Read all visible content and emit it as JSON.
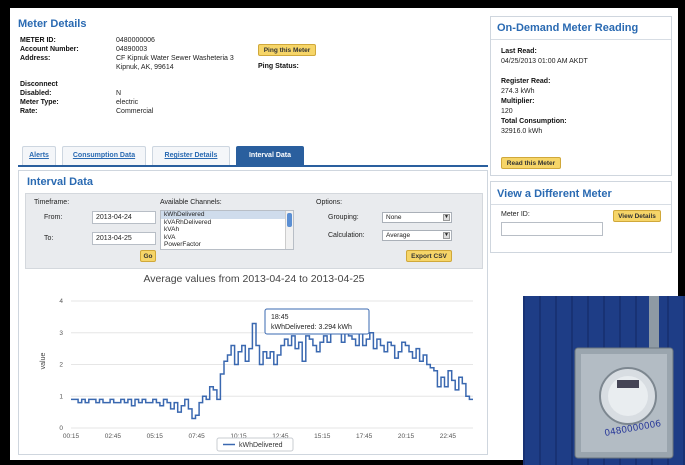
{
  "meter_details": {
    "title": "Meter Details",
    "fields": [
      {
        "label": "METER ID:",
        "value": "0480000006"
      },
      {
        "label": "Account Number:",
        "value": "04890003"
      },
      {
        "label": "Address:",
        "value": "CF Kipnuk Water Sewer Washeteria 3"
      },
      {
        "label": "",
        "value": "Kipnuk, AK, 99614"
      },
      {
        "label": "Disconnect",
        "value": ""
      },
      {
        "label": "Disabled:",
        "value": "N"
      },
      {
        "label": "Meter Type:",
        "value": "electric"
      },
      {
        "label": "Rate:",
        "value": "Commercial"
      }
    ],
    "ping_button": "Ping this Meter",
    "ping_status_label": "Ping Status:"
  },
  "tabs": [
    {
      "label": "Alerts",
      "active": false
    },
    {
      "label": "Consumption Data",
      "active": false
    },
    {
      "label": "Register Details",
      "active": false
    },
    {
      "label": "Interval Data",
      "active": true
    }
  ],
  "interval": {
    "title": "Interval Data",
    "timeframe_label": "Timeframe:",
    "from_label": "From:",
    "from_value": "2013-04-24",
    "to_label": "To:",
    "to_value": "2013-04-25",
    "go_button": "Go",
    "channels_label": "Available Channels:",
    "channels": [
      "kWhDelivered",
      "kVARhDelivered",
      "kVAh",
      "kVA",
      "PowerFactor"
    ],
    "selected_channel": "kWhDelivered",
    "options_label": "Options:",
    "grouping_label": "Grouping:",
    "grouping_value": "None",
    "calculation_label": "Calculation:",
    "calculation_value": "Average",
    "export_button": "Export CSV"
  },
  "chart_data": {
    "type": "line",
    "title": "Average values from 2013-04-24 to 2013-04-25",
    "xlabel": "",
    "ylabel": "value",
    "ylim": [
      0,
      4
    ],
    "yticks": [
      "0",
      "1",
      "2",
      "3",
      "4"
    ],
    "xticks": [
      "00:15",
      "02:45",
      "05:15",
      "07:45",
      "10:15",
      "12:45",
      "15:15",
      "17:45",
      "20:15",
      "22:45"
    ],
    "legend": "bottom-center",
    "series": [
      {
        "name": "kWhDelivered",
        "color": "#3a68b0",
        "values": [
          0.9,
          0.9,
          0.8,
          0.9,
          0.8,
          0.9,
          0.9,
          0.8,
          0.9,
          0.8,
          0.8,
          0.9,
          0.8,
          0.8,
          0.9,
          0.8,
          0.9,
          0.7,
          0.9,
          0.8,
          0.9,
          0.8,
          0.8,
          0.9,
          0.8,
          0.7,
          0.9,
          0.8,
          0.6,
          0.8,
          0.5,
          0.7,
          0.9,
          0.6,
          0.3,
          0.4,
          0.8,
          1.0,
          0.9,
          1.3,
          1.2,
          0.9,
          1.7,
          2.1,
          2.3,
          2.6,
          2.0,
          2.4,
          2.6,
          2.1,
          2.5,
          3.29,
          2.6,
          2.0,
          2.4,
          2.2,
          2.4,
          2.0,
          2.3,
          2.6,
          2.8,
          2.6,
          2.9,
          2.5,
          2.7,
          2.1,
          2.9,
          2.8,
          2.6,
          2.4,
          2.7,
          2.9,
          2.7,
          3.0,
          3.2,
          3.0,
          2.7,
          3.2,
          2.9,
          2.8,
          2.6,
          3.0,
          2.6,
          2.8,
          3.0,
          2.5,
          2.8,
          2.6,
          2.4,
          2.7,
          2.6,
          2.2,
          2.4,
          2.7,
          2.6,
          2.4,
          2.2,
          2.5,
          2.1,
          2.3,
          2.0,
          1.9,
          1.8,
          1.3,
          1.6,
          1.3,
          1.8,
          1.5,
          1.2,
          1.6,
          1.4,
          1.0,
          0.9
        ]
      }
    ],
    "tooltip": {
      "time": "18:45",
      "text": "kWhDelivered: 3.294 kWh"
    }
  },
  "ondemand": {
    "title": "On-Demand Meter Reading",
    "last_read_label": "Last Read:",
    "last_read_value": "04/25/2013 01:00 AM AKDT",
    "register_read_label": "Register Read:",
    "register_read_value": "274.3 kWh",
    "multiplier_label": "Multiplier:",
    "multiplier_value": "120",
    "total_label": "Total Consumption:",
    "total_value": "32916.0 kWh",
    "read_button": "Read this Meter"
  },
  "view_meter": {
    "title": "View a Different Meter",
    "meter_id_label": "Meter ID:",
    "meter_id_value": "",
    "view_button": "View Details"
  },
  "photo": {
    "meter_label": "0480000006"
  }
}
